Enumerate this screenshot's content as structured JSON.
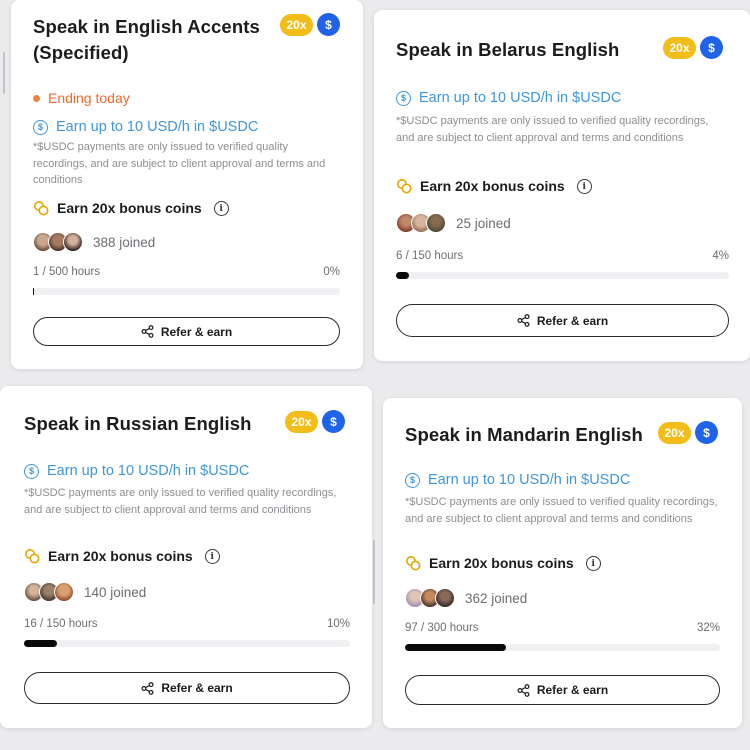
{
  "cards": [
    {
      "title": "Speak in English Accents (Specified)",
      "badge_multiplier": "20x",
      "badge_currency": "$",
      "status": "Ending today",
      "earn": "Earn up to 10 USD/h in $USDC",
      "earn_icon": "$",
      "disclaimer": "*$USDC payments are only issued to verified quality recordings, and are subject to client approval and terms and conditions",
      "bonus": "Earn 20x bonus coins",
      "info_icon": "i",
      "joined": "388 joined",
      "hours": "1 / 500 hours",
      "percent": "0%",
      "progress": 0.002,
      "refer_label": "Refer & earn"
    },
    {
      "title": "Speak in Belarus English",
      "badge_multiplier": "20x",
      "badge_currency": "$",
      "earn": "Earn up to 10 USD/h in $USDC",
      "earn_icon": "$",
      "disclaimer": "*$USDC payments are only issued to verified quality recordings, and are subject to client approval and terms and conditions",
      "bonus": "Earn 20x bonus coins",
      "info_icon": "i",
      "joined": "25 joined",
      "hours": "6 / 150 hours",
      "percent": "4%",
      "progress": 0.04,
      "refer_label": "Refer & earn"
    },
    {
      "title": "Speak in Russian English",
      "badge_multiplier": "20x",
      "badge_currency": "$",
      "earn": "Earn up to 10 USD/h in $USDC",
      "earn_icon": "$",
      "disclaimer": "*$USDC payments are only issued to verified quality recordings, and are subject to client approval and terms and conditions",
      "bonus": "Earn 20x bonus coins",
      "info_icon": "i",
      "joined": "140 joined",
      "hours": "16 / 150 hours",
      "percent": "10%",
      "progress": 0.1,
      "refer_label": "Refer & earn"
    },
    {
      "title": "Speak in Mandarin English",
      "badge_multiplier": "20x",
      "badge_currency": "$",
      "earn": "Earn up to 10 USD/h in $USDC",
      "earn_icon": "$",
      "disclaimer": "*$USDC payments are only issued to verified quality recordings, and are subject to client approval and terms and conditions",
      "bonus": "Earn 20x bonus coins",
      "info_icon": "i",
      "joined": "362 joined",
      "hours": "97 / 300 hours",
      "percent": "32%",
      "progress": 0.32,
      "refer_label": "Refer & earn"
    }
  ],
  "colors": {
    "badge_yellow": "#f2bd18",
    "badge_blue": "#1f63e8",
    "earn_blue": "#3f96dd",
    "ending_orange": "#f06a2c",
    "progress_fill": "#0a0a0a"
  },
  "icons": {
    "earn": "usd-circle-icon",
    "bonus": "coins-icon",
    "info": "info-icon",
    "refer": "share-icon"
  }
}
